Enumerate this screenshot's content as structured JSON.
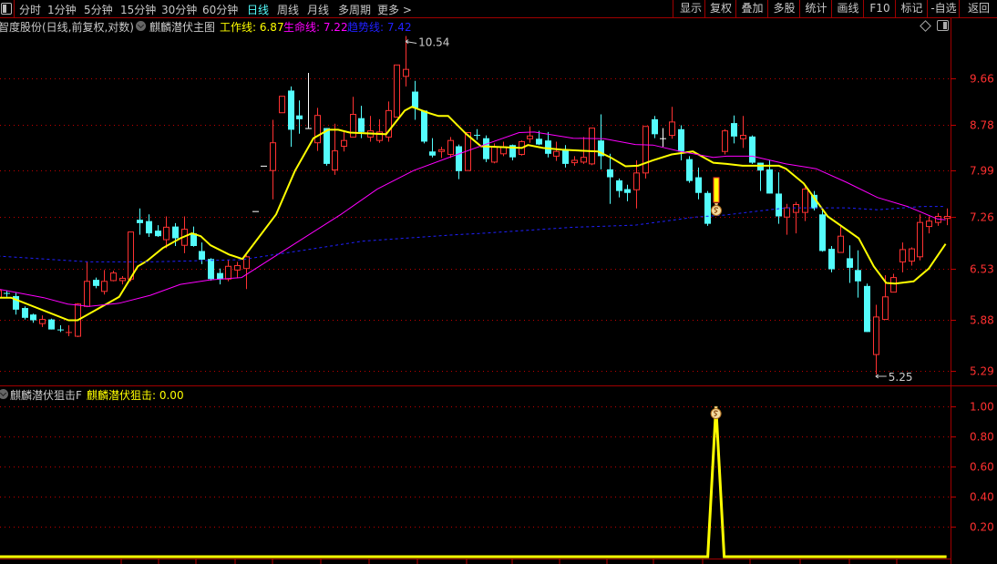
{
  "toolbar": {
    "periods": [
      "分时",
      "1分钟",
      "5分钟",
      "15分钟",
      "30分钟",
      "60分钟",
      "日线",
      "周线",
      "月线",
      "多周期",
      "更多 >"
    ],
    "active_period": "日线",
    "buttons": [
      "显示",
      "复权",
      "叠加",
      "多股",
      "统计",
      "画线",
      "F10",
      "标记",
      "-自选",
      "返回"
    ]
  },
  "main_legend": {
    "stock": "智度股份(日线,前复权,对数)",
    "indicator": "麒麟潜伏主图",
    "work_line": "工作线: 6.87",
    "life_line": "生命线: 7.22",
    "trend_line": "趋势线: 7.42"
  },
  "sub_legend": {
    "indicator": "麒麟潜伏狙击F",
    "value": "麒麟潜伏狙击: 0.00"
  },
  "colors": {
    "up": "#ff3232",
    "down": "#54fcfc",
    "flat": "#ffffff",
    "work": "#ffff00",
    "life": "#ff00ff",
    "trend": "#2020ff",
    "grid": "#c00000",
    "axis_text": "#ff3030"
  },
  "chart_data": [
    {
      "type": "candlestick",
      "scale": "log",
      "y_ticks": [
        9.66,
        8.78,
        7.99,
        7.26,
        6.53,
        5.88,
        5.29
      ],
      "y_tick_labels": [
        "9.66",
        "8.78",
        "7.99",
        "7.26",
        "6.53",
        "5.88",
        "5.29"
      ],
      "annotations": {
        "high": {
          "index": 46,
          "value": 10.54,
          "label": "10.54"
        },
        "low": {
          "index": 99,
          "value": 5.25,
          "label": "5.25"
        }
      },
      "signal_index": 81,
      "ohlc": [
        [
          6.15,
          6.26,
          6.12,
          6.24
        ],
        [
          6.21,
          6.24,
          6.16,
          6.2
        ],
        [
          6.17,
          6.21,
          5.94,
          6.0
        ],
        [
          6.02,
          6.04,
          5.88,
          5.9
        ],
        [
          5.94,
          5.95,
          5.84,
          5.87
        ],
        [
          5.83,
          5.93,
          5.79,
          5.88
        ],
        [
          5.88,
          5.89,
          5.76,
          5.76
        ],
        [
          5.76,
          5.81,
          5.73,
          5.75
        ],
        [
          5.72,
          5.81,
          5.68,
          5.73
        ],
        [
          5.68,
          6.08,
          5.67,
          6.07
        ],
        [
          6.04,
          6.62,
          6.03,
          6.36
        ],
        [
          6.38,
          6.41,
          6.27,
          6.3
        ],
        [
          6.23,
          6.51,
          6.19,
          6.36
        ],
        [
          6.37,
          6.5,
          6.36,
          6.47
        ],
        [
          6.37,
          6.43,
          6.32,
          6.4
        ],
        [
          6.39,
          7.04,
          6.36,
          7.04
        ],
        [
          7.22,
          7.39,
          7.0,
          7.17
        ],
        [
          7.2,
          7.3,
          6.97,
          7.02
        ],
        [
          7.06,
          7.14,
          6.97,
          6.98
        ],
        [
          6.93,
          7.27,
          6.81,
          7.11
        ],
        [
          7.12,
          7.17,
          6.84,
          6.95
        ],
        [
          6.85,
          7.27,
          6.74,
          7.08
        ],
        [
          7.02,
          7.12,
          6.83,
          6.84
        ],
        [
          6.77,
          6.89,
          6.59,
          6.65
        ],
        [
          6.66,
          6.67,
          6.37,
          6.39
        ],
        [
          6.47,
          6.53,
          6.32,
          6.39
        ],
        [
          6.39,
          6.65,
          6.36,
          6.56
        ],
        [
          6.51,
          6.62,
          6.4,
          6.57
        ],
        [
          6.53,
          6.71,
          6.26,
          6.69
        ],
        [
          7.35,
          7.35,
          7.35,
          7.35
        ],
        [
          8.07,
          8.07,
          8.07,
          8.07
        ],
        [
          7.99,
          8.87,
          7.53,
          8.46
        ],
        [
          9.0,
          9.31,
          9.0,
          9.31
        ],
        [
          9.42,
          9.5,
          8.39,
          8.69
        ],
        [
          8.95,
          9.23,
          8.62,
          8.88
        ],
        [
          8.72,
          9.77,
          8.72,
          8.72
        ],
        [
          8.46,
          9.09,
          8.32,
          8.95
        ],
        [
          8.72,
          8.72,
          8.07,
          8.1
        ],
        [
          8.0,
          8.8,
          7.92,
          8.32
        ],
        [
          8.4,
          8.65,
          8.31,
          8.5
        ],
        [
          8.56,
          9.3,
          8.56,
          8.97
        ],
        [
          8.9,
          9.13,
          8.54,
          8.65
        ],
        [
          8.56,
          8.94,
          8.48,
          8.67
        ],
        [
          8.5,
          8.88,
          8.46,
          8.65
        ],
        [
          8.56,
          9.21,
          8.48,
          9.04
        ],
        [
          8.92,
          9.93,
          8.92,
          9.93
        ],
        [
          9.7,
          10.54,
          9.5,
          9.84
        ],
        [
          9.4,
          9.61,
          8.87,
          9.09
        ],
        [
          9.04,
          9.04,
          8.45,
          8.48
        ],
        [
          8.31,
          8.54,
          8.21,
          8.24
        ],
        [
          8.31,
          8.39,
          8.2,
          8.34
        ],
        [
          8.26,
          8.56,
          8.2,
          8.5
        ],
        [
          8.4,
          8.43,
          7.85,
          7.98
        ],
        [
          7.99,
          8.64,
          7.99,
          8.64
        ],
        [
          8.6,
          8.7,
          8.51,
          8.59
        ],
        [
          8.54,
          8.59,
          8.13,
          8.18
        ],
        [
          8.13,
          8.45,
          8.11,
          8.39
        ],
        [
          8.27,
          8.48,
          8.23,
          8.39
        ],
        [
          8.42,
          8.43,
          8.16,
          8.21
        ],
        [
          8.26,
          8.5,
          8.24,
          8.48
        ],
        [
          8.53,
          8.75,
          8.46,
          8.58
        ],
        [
          8.53,
          8.67,
          8.42,
          8.43
        ],
        [
          8.5,
          8.65,
          8.21,
          8.27
        ],
        [
          8.23,
          8.48,
          8.15,
          8.31
        ],
        [
          8.34,
          8.42,
          8.04,
          8.1
        ],
        [
          8.12,
          8.23,
          8.07,
          8.16
        ],
        [
          8.13,
          8.56,
          8.1,
          8.21
        ],
        [
          8.1,
          8.72,
          8.08,
          8.72
        ],
        [
          8.5,
          8.97,
          8.01,
          8.23
        ],
        [
          8.01,
          8.27,
          7.46,
          7.88
        ],
        [
          7.83,
          7.86,
          7.56,
          7.66
        ],
        [
          7.69,
          7.76,
          7.5,
          7.63
        ],
        [
          7.68,
          8.16,
          7.39,
          7.95
        ],
        [
          7.95,
          8.75,
          7.86,
          8.75
        ],
        [
          8.88,
          8.94,
          8.54,
          8.61
        ],
        [
          8.54,
          8.72,
          8.39,
          8.54
        ],
        [
          8.59,
          9.11,
          8.53,
          8.83
        ],
        [
          8.7,
          8.77,
          8.16,
          8.31
        ],
        [
          8.18,
          8.23,
          7.79,
          7.82
        ],
        [
          7.88,
          8.04,
          7.53,
          7.63
        ],
        [
          7.63,
          7.66,
          7.13,
          7.16
        ],
        null,
        [
          8.31,
          8.7,
          8.26,
          8.67
        ],
        [
          8.81,
          8.95,
          8.45,
          8.57
        ],
        [
          8.53,
          8.94,
          8.37,
          8.59
        ],
        [
          8.57,
          8.59,
          8.1,
          8.12
        ],
        [
          8.12,
          8.12,
          7.66,
          7.99
        ],
        [
          8.01,
          8.16,
          7.62,
          7.62
        ],
        [
          7.62,
          7.96,
          7.16,
          7.27
        ],
        [
          7.26,
          7.46,
          7.0,
          7.4
        ],
        [
          7.33,
          7.49,
          7.02,
          7.45
        ],
        [
          7.33,
          7.74,
          7.2,
          7.69
        ],
        [
          7.6,
          7.66,
          7.36,
          7.39
        ],
        [
          7.3,
          7.37,
          6.76,
          6.77
        ],
        [
          6.8,
          6.84,
          6.48,
          6.52
        ],
        [
          6.75,
          7.14,
          6.75,
          6.98
        ],
        [
          6.67,
          6.85,
          6.34,
          6.54
        ],
        [
          6.51,
          6.78,
          6.15,
          6.36
        ],
        [
          6.3,
          6.33,
          5.73,
          5.73
        ],
        [
          5.47,
          6.06,
          5.25,
          5.91
        ],
        [
          5.88,
          6.44,
          5.88,
          6.16
        ],
        [
          6.22,
          6.46,
          6.22,
          6.41
        ],
        [
          6.62,
          6.89,
          6.48,
          6.79
        ],
        [
          6.63,
          6.82,
          6.57,
          6.8
        ],
        [
          6.69,
          7.3,
          6.64,
          7.18
        ],
        [
          7.12,
          7.27,
          7.02,
          7.2
        ],
        [
          7.18,
          7.32,
          7.13,
          7.27
        ],
        [
          7.24,
          7.39,
          7.14,
          7.27
        ]
      ],
      "series": [
        {
          "name": "工作线",
          "points": [
            [
              0,
              6.15
            ],
            [
              1.5,
              6.15
            ],
            [
              8,
              5.87
            ],
            [
              9,
              5.87
            ],
            [
              13.7,
              6.16
            ],
            [
              15.8,
              6.56
            ],
            [
              16.8,
              6.63
            ],
            [
              18.6,
              6.81
            ],
            [
              20.6,
              6.95
            ],
            [
              21.9,
              7.02
            ],
            [
              22.9,
              6.98
            ],
            [
              24,
              6.85
            ],
            [
              26.1,
              6.72
            ],
            [
              27.6,
              6.66
            ],
            [
              31.4,
              7.3
            ],
            [
              33.5,
              7.98
            ],
            [
              35.6,
              8.54
            ],
            [
              37.3,
              8.69
            ],
            [
              38.4,
              8.69
            ],
            [
              39.7,
              8.64
            ],
            [
              43.8,
              8.61
            ],
            [
              45.9,
              9.04
            ],
            [
              46.7,
              9.11
            ],
            [
              48.7,
              8.99
            ],
            [
              49.7,
              8.94
            ],
            [
              50.8,
              8.94
            ],
            [
              52.8,
              8.62
            ],
            [
              54.5,
              8.4
            ],
            [
              59.1,
              8.37
            ],
            [
              59.8,
              8.42
            ],
            [
              61.5,
              8.37
            ],
            [
              63.6,
              8.34
            ],
            [
              67.7,
              8.31
            ],
            [
              69.1,
              8.21
            ],
            [
              70.8,
              8.06
            ],
            [
              72.2,
              8.07
            ],
            [
              73.9,
              8.16
            ],
            [
              76,
              8.26
            ],
            [
              78.4,
              8.31
            ],
            [
              80.7,
              8.12
            ],
            [
              82.2,
              8.1
            ],
            [
              84,
              8.07
            ],
            [
              88.1,
              8.07
            ],
            [
              88.9,
              8.02
            ],
            [
              90.9,
              7.78
            ],
            [
              93.6,
              7.27
            ],
            [
              97.1,
              6.95
            ],
            [
              98.8,
              6.56
            ],
            [
              100.2,
              6.34
            ],
            [
              101.2,
              6.33
            ],
            [
              103.3,
              6.36
            ],
            [
              105,
              6.53
            ],
            [
              106.9,
              6.87
            ]
          ]
        },
        {
          "name": "生命线",
          "points": [
            [
              0,
              6.26
            ],
            [
              5.2,
              6.15
            ],
            [
              7.9,
              6.07
            ],
            [
              10.3,
              6.04
            ],
            [
              13.7,
              6.08
            ],
            [
              17.2,
              6.18
            ],
            [
              20.6,
              6.32
            ],
            [
              24,
              6.38
            ],
            [
              27.5,
              6.41
            ],
            [
              38.7,
              7.3
            ],
            [
              42.8,
              7.69
            ],
            [
              46.9,
              7.99
            ],
            [
              51.3,
              8.23
            ],
            [
              54.8,
              8.42
            ],
            [
              58.8,
              8.64
            ],
            [
              60.5,
              8.65
            ],
            [
              64.9,
              8.54
            ],
            [
              68.4,
              8.53
            ],
            [
              71.9,
              8.43
            ],
            [
              73.9,
              8.42
            ],
            [
              77,
              8.31
            ],
            [
              80.7,
              8.21
            ],
            [
              82.2,
              8.23
            ],
            [
              85.1,
              8.23
            ],
            [
              88.9,
              8.1
            ],
            [
              92.3,
              8.02
            ],
            [
              95.7,
              7.8
            ],
            [
              99.2,
              7.56
            ],
            [
              102.6,
              7.42
            ],
            [
              106,
              7.23
            ],
            [
              106.9,
              7.22
            ]
          ]
        },
        {
          "name": "趋势线",
          "points": [
            [
              0,
              6.7
            ],
            [
              10.3,
              6.62
            ],
            [
              17.2,
              6.62
            ],
            [
              27.5,
              6.65
            ],
            [
              41.2,
              6.91
            ],
            [
              51.5,
              7.0
            ],
            [
              54.6,
              7.02
            ],
            [
              64.9,
              7.11
            ],
            [
              71.9,
              7.14
            ],
            [
              78.7,
              7.26
            ],
            [
              82,
              7.29
            ],
            [
              88.9,
              7.4
            ],
            [
              95.7,
              7.4
            ],
            [
              99.2,
              7.37
            ],
            [
              104.3,
              7.42
            ],
            [
              106.9,
              7.42
            ]
          ]
        }
      ]
    },
    {
      "type": "line",
      "name": "麒麟潜伏狙击",
      "y_ticks": [
        1.0,
        0.8,
        0.6,
        0.4,
        0.2
      ],
      "y_tick_labels": [
        "1.00",
        "0.80",
        "0.60",
        "0.40",
        "0.20"
      ],
      "ylim": [
        0,
        1.0
      ],
      "signal_index": 81,
      "signal_value": 1.0,
      "baseline_value": 0.0
    }
  ]
}
